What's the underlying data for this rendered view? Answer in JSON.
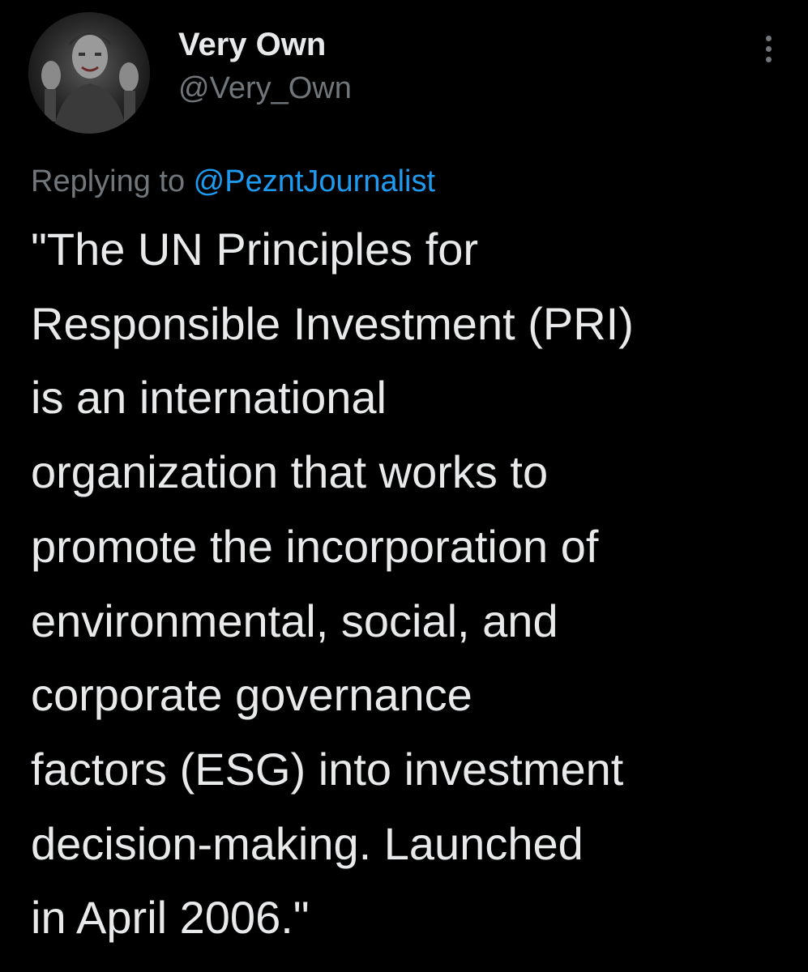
{
  "author": {
    "display_name": "Very Own",
    "handle": "@Very_Own",
    "avatar_icon": "user-avatar-photo"
  },
  "reply": {
    "prefix": "Replying to ",
    "mention": "@PezntJournalist"
  },
  "tweet": {
    "text": "\"The UN Principles for\nResponsible Investment (PRI)\nis an international\norganization that works to\npromote the incorporation of\nenvironmental, social, and\ncorporate governance\nfactors (ESG) into investment\ndecision-making. Launched\nin April 2006.\""
  },
  "menu": {
    "more_icon": "more-vertical-icon"
  },
  "colors": {
    "background": "#000000",
    "text_primary": "#e7e9ea",
    "text_secondary": "#71767b",
    "link": "#1d9bf0"
  }
}
